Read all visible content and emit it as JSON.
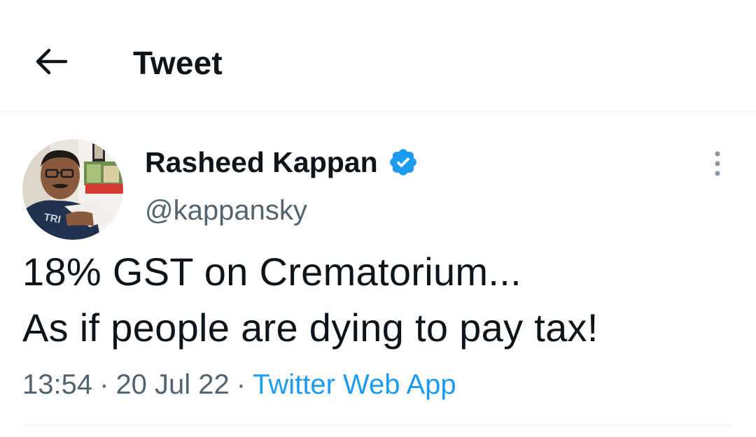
{
  "header": {
    "back_icon": "arrow-left-icon",
    "title": "Tweet"
  },
  "tweet": {
    "author": {
      "name": "Rasheed Kappan",
      "handle": "@kappansky",
      "verified": true,
      "verified_icon": "verified-badge-icon"
    },
    "more_icon": "more-vertical-icon",
    "text_lines": [
      "18% GST on Crematorium...",
      "As if people are dying to pay tax!"
    ],
    "time": "13:54",
    "date": "20 Jul 22",
    "separator": "·",
    "source": "Twitter Web App"
  },
  "colors": {
    "text_primary": "#0f1419",
    "text_secondary": "#536471",
    "accent": "#1d9bf0",
    "divider": "#eff3f4"
  }
}
